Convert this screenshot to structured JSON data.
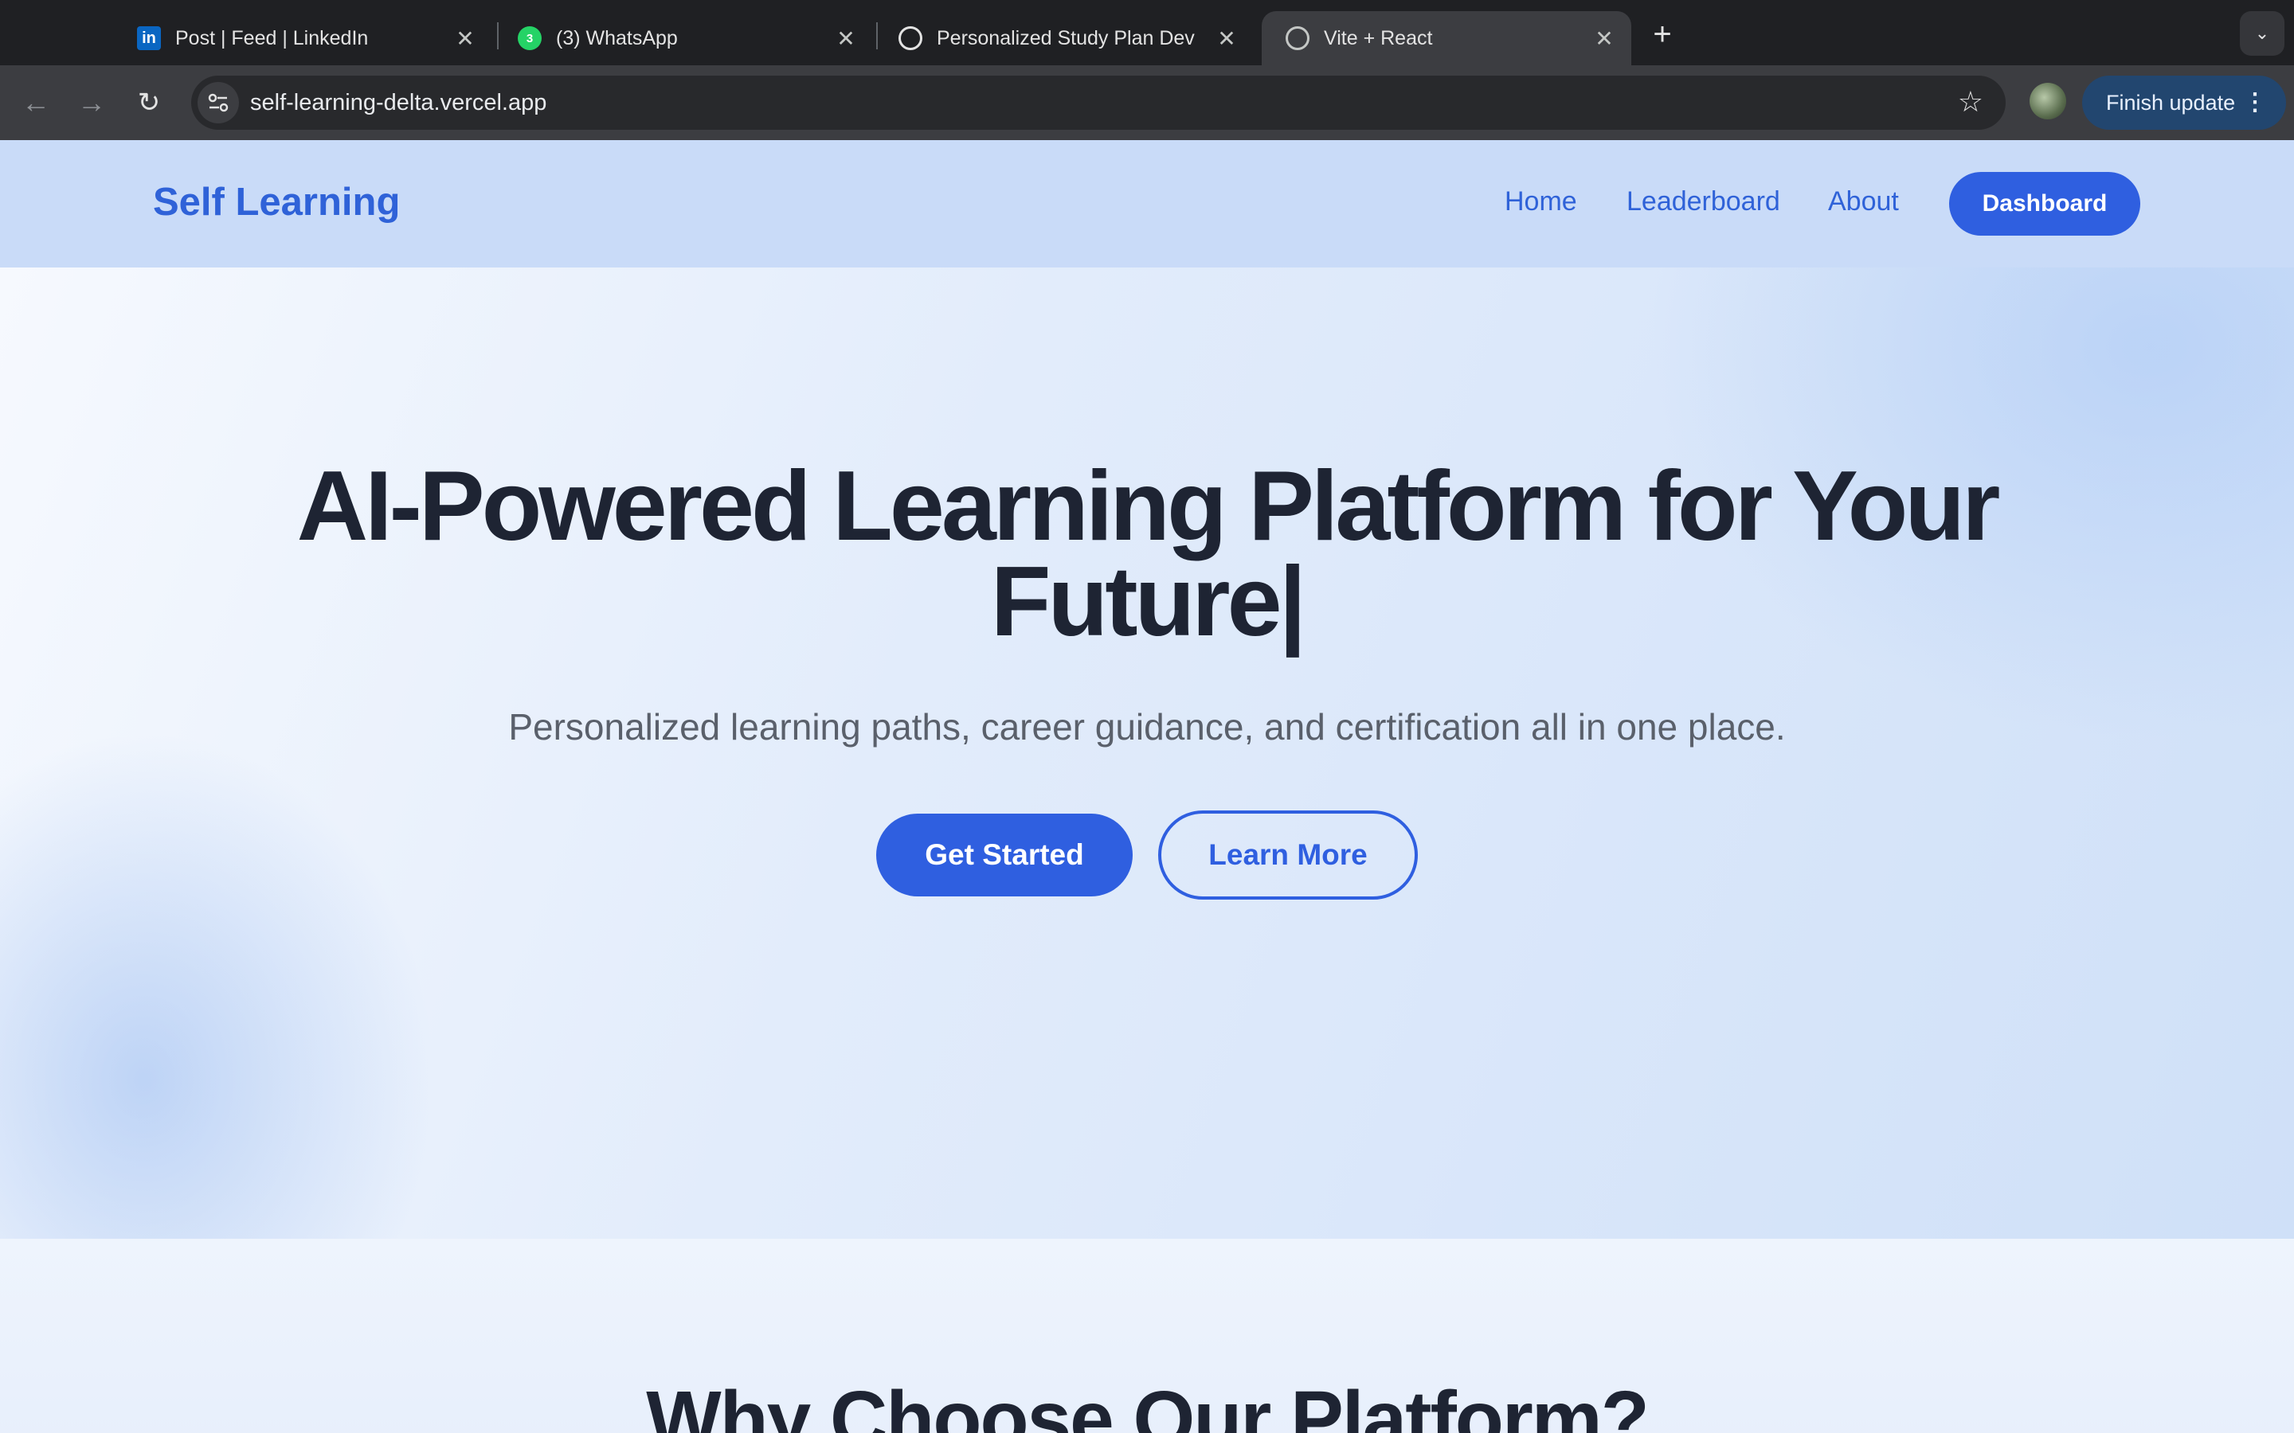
{
  "browser": {
    "tabs": [
      {
        "title": "Post | Feed | LinkedIn",
        "icon": "linkedin-icon",
        "favicon_text": "in",
        "active": false
      },
      {
        "title": "(3) WhatsApp",
        "icon": "whatsapp-icon",
        "favicon_text": "3",
        "active": false
      },
      {
        "title": "Personalized Study Plan Dev",
        "icon": "openai-icon",
        "active": false
      },
      {
        "title": "Vite + React",
        "icon": "globe-icon",
        "active": true
      }
    ],
    "url": "self-learning-delta.vercel.app",
    "finish_update_label": "Finish update"
  },
  "site": {
    "logo": "Self Learning",
    "nav": {
      "home": "Home",
      "leaderboard": "Leaderboard",
      "about": "About",
      "dashboard": "Dashboard"
    },
    "hero": {
      "title": "AI-Powered Learning Platform for Your Future|",
      "subtitle": "Personalized learning paths, career guidance, and certification all in one place.",
      "cta_primary": "Get Started",
      "cta_secondary": "Learn More"
    },
    "features": {
      "title": "Why Choose Our Platform?"
    }
  },
  "colors": {
    "brand": "#2f5fe0",
    "header_bg": "#c9dbf8",
    "title_text": "#1e2433"
  }
}
